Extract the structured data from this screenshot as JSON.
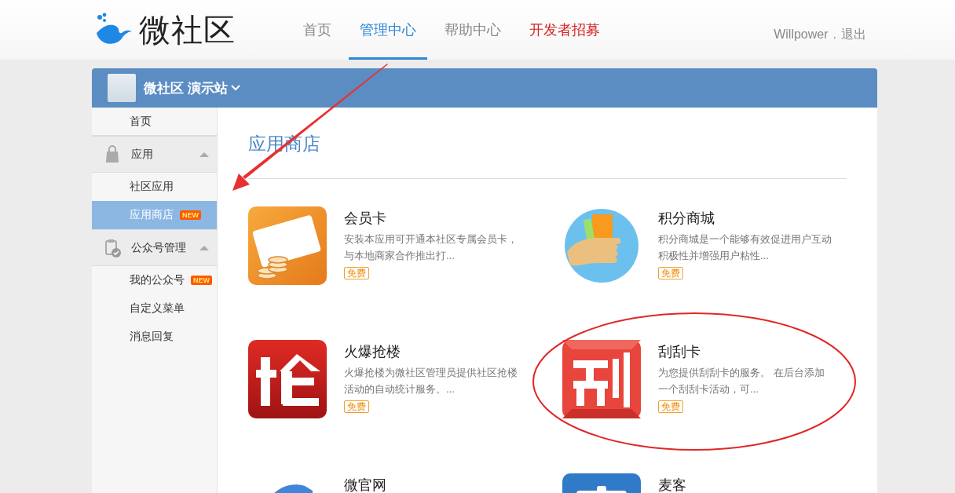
{
  "header": {
    "logo": "微社区",
    "nav": [
      {
        "label": "首页",
        "selected": false,
        "highlighted": false
      },
      {
        "label": "管理中心",
        "selected": true,
        "highlighted": false
      },
      {
        "label": "帮助中心",
        "selected": false,
        "highlighted": false
      },
      {
        "label": "开发者招募",
        "selected": false,
        "highlighted": true
      }
    ],
    "user": {
      "name": "Willpower",
      "separator": ".",
      "logout": "退出"
    }
  },
  "site": {
    "name": "微社区 演示站"
  },
  "sidebar": {
    "items": [
      {
        "kind": "link",
        "label": "首页",
        "selected": false
      },
      {
        "kind": "group",
        "label": "应用",
        "expanded": true,
        "children": [
          {
            "label": "社区应用",
            "selected": false
          },
          {
            "label": "应用商店",
            "selected": true,
            "badge": "NEW"
          }
        ]
      },
      {
        "kind": "group",
        "label": "公众号管理",
        "expanded": true,
        "children": [
          {
            "label": "我的公众号",
            "selected": false,
            "badge": "NEW"
          },
          {
            "label": "自定义菜单",
            "selected": false
          },
          {
            "label": "消息回复",
            "selected": false
          }
        ]
      }
    ]
  },
  "content": {
    "title": "应用商店",
    "apps": [
      {
        "name": "会员卡",
        "kind": "vip",
        "description": "安装本应用可开通本社区专属会员卡，与本地商家合作推出打...",
        "price": "免费"
      },
      {
        "name": "积分商城",
        "kind": "points",
        "description": "积分商城是一个能够有效促进用户互动积极性并增强用户粘性...",
        "price": "免费"
      },
      {
        "name": "火爆抢楼",
        "kind": "grab",
        "description": "火爆抢楼为微社区管理员提供社区抢楼活动的自动统计服务。...",
        "price": "免费"
      },
      {
        "name": "刮刮卡",
        "kind": "scratch",
        "description": "为您提供刮刮卡的服务。 在后台添加一个刮刮卡活动，可...",
        "price": "免费"
      },
      {
        "name": "微官网",
        "kind": "website"
      },
      {
        "name": "麦客",
        "kind": "form"
      }
    ]
  },
  "annotations": [
    {
      "kind": "arrow"
    },
    {
      "kind": "ellipse"
    }
  ]
}
